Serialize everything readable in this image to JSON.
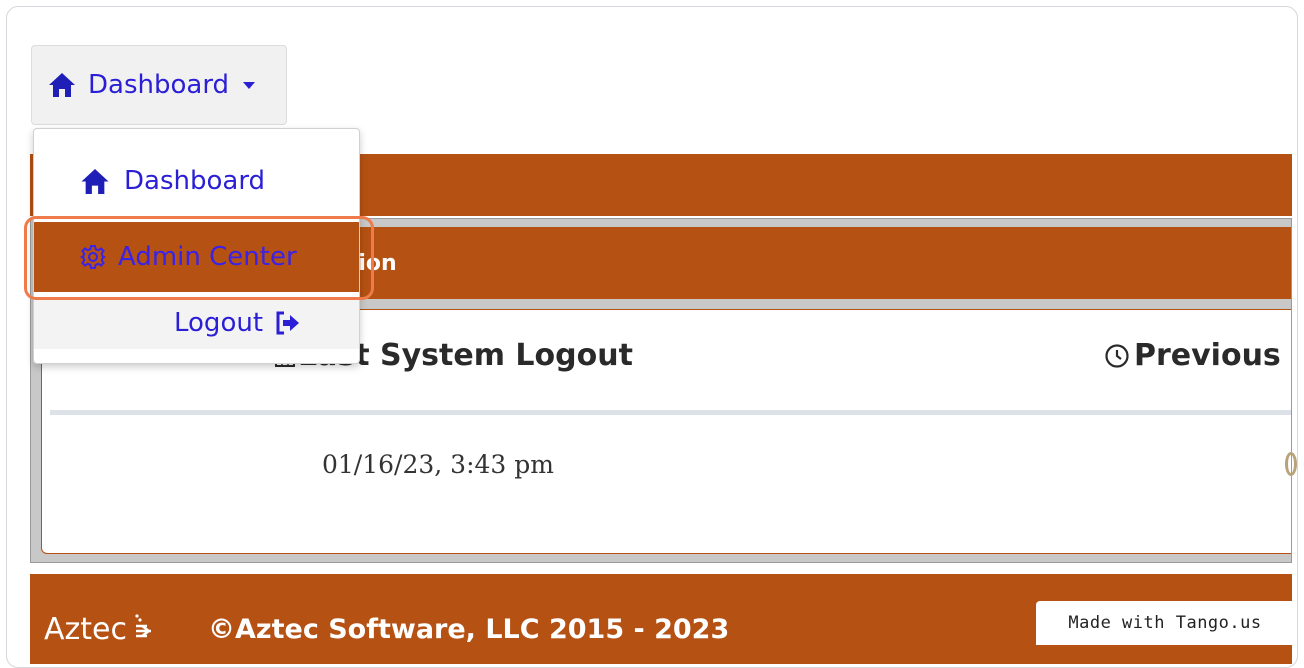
{
  "nav": {
    "toggle_label": "Dashboard",
    "menu": {
      "dashboard": "Dashboard",
      "admin_center": "Admin Center",
      "logout": "Logout"
    }
  },
  "panel": {
    "header_partial": "ation",
    "last_logout_title": "Last System Logout",
    "previous_title": "Previous",
    "last_logout_value": "01/16/23, 3:43 pm"
  },
  "footer": {
    "brand": "Aztec",
    "copyright": "©Aztec Software, LLC 2015 - 2023"
  },
  "watermark": "Made with Tango.us",
  "colors": {
    "brand_orange": "#b45113",
    "link_blue": "#2b1fd6",
    "highlight": "#ef7b4a"
  }
}
